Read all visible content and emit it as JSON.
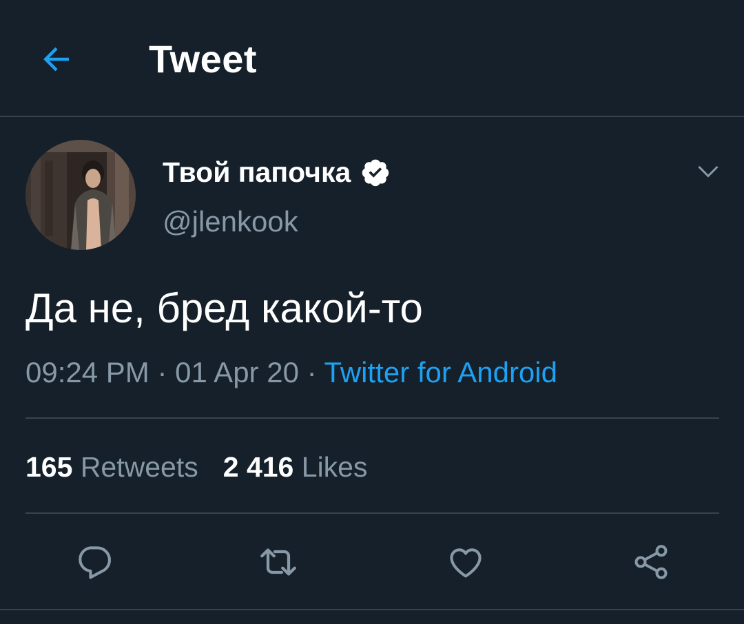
{
  "header": {
    "title": "Tweet",
    "back_icon": "arrow-left-icon"
  },
  "author": {
    "display_name": "Твой папочка",
    "handle": "@jlenkook",
    "verified": true,
    "verified_icon": "verified-badge-icon"
  },
  "tweet": {
    "text": "Да не, бред какой-то",
    "time": "09:24 PM",
    "separator": " · ",
    "date": "01 Apr 20",
    "source": "Twitter for Android"
  },
  "stats": {
    "retweets_count": "165",
    "retweets_label": "Retweets",
    "likes_count": "2 416",
    "likes_label": "Likes"
  },
  "actions": [
    {
      "name": "reply",
      "icon": "reply-icon"
    },
    {
      "name": "retweet",
      "icon": "retweet-icon"
    },
    {
      "name": "like",
      "icon": "heart-icon"
    },
    {
      "name": "share",
      "icon": "share-icon"
    }
  ],
  "colors": {
    "background": "#15202b",
    "accent": "#1da1f2",
    "secondary_text": "#8899a6",
    "divider": "#38444d"
  }
}
